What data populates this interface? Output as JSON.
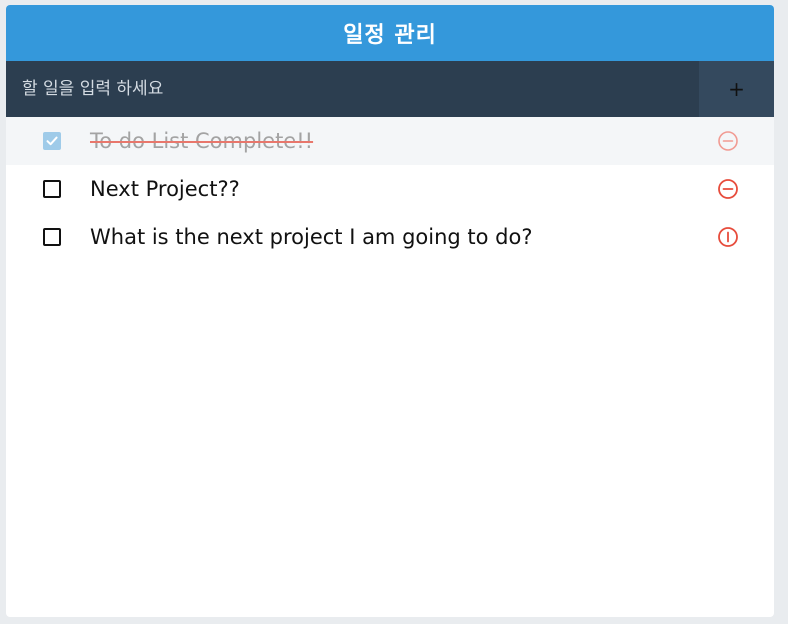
{
  "header": {
    "title": "일정 관리"
  },
  "insert": {
    "placeholder": "할 일을 입력 하세요",
    "add_label": "+"
  },
  "todos": [
    {
      "text": "To do List Complete!!",
      "checked": true
    },
    {
      "text": "Next Project??",
      "checked": false
    },
    {
      "text": "What is the next project I am going to do?",
      "checked": false
    }
  ],
  "icons": {
    "checkbox_checked": "checkbox-checked-icon",
    "checkbox_empty": "checkbox-empty-icon",
    "remove": "minus-circle-icon"
  },
  "colors": {
    "header": "#3498db",
    "insert_bar": "#2c3e50",
    "add_button": "#34495e",
    "remove_icon": "#e74c3c",
    "checked_box": "#9fcbe9"
  }
}
